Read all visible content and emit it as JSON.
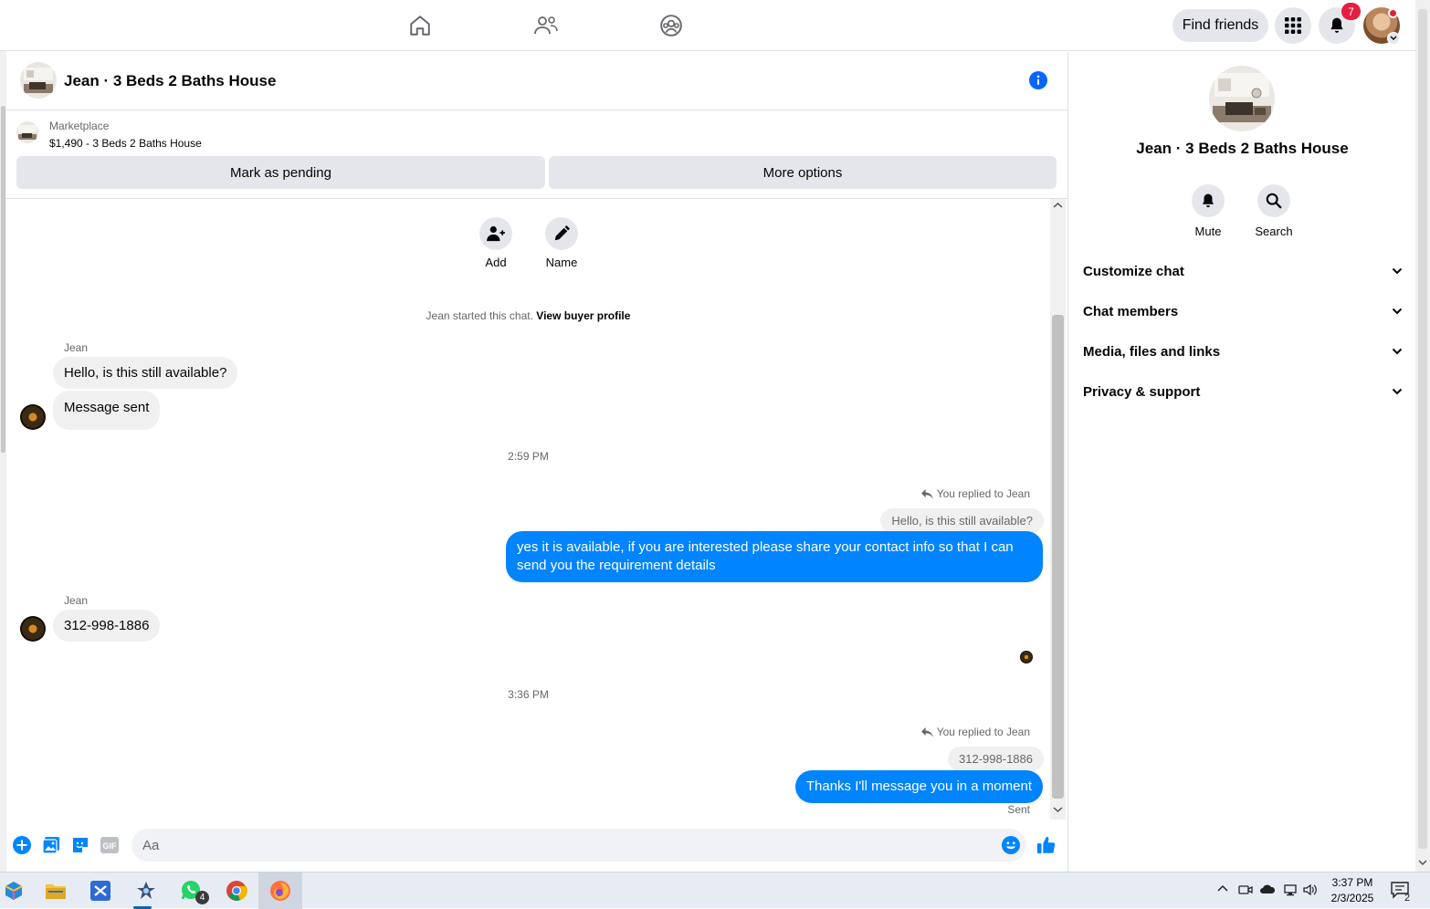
{
  "topnav": {
    "find_friends_label": "Find friends",
    "notifications_count": "7"
  },
  "chat": {
    "header_title": "Jean · 3 Beds 2 Baths House",
    "marketplace_label": "Marketplace",
    "listing_text": "$1,490 - 3 Beds 2 Baths House",
    "mark_pending_label": "Mark as pending",
    "more_options_label": "More options"
  },
  "thread_tools": {
    "add_label": "Add",
    "name_label": "Name"
  },
  "messages": {
    "started_text": "Jean started this chat.",
    "view_profile_link": "View buyer profile",
    "sender_name_1": "Jean",
    "in_msg_1": "Hello, is this still available?",
    "in_msg_2": "Message sent",
    "time_1": "2:59 PM",
    "reply_note_1": "You replied to Jean",
    "quote_1": "Hello, is this still available?",
    "out_msg_1": "yes it is available, if you are interested please share your contact info so that I can send you the requirement details",
    "sender_name_2": "Jean",
    "in_msg_3": "312-998-1886",
    "time_2": "3:36 PM",
    "reply_note_2": "You replied to Jean",
    "quote_2": "312-998-1886",
    "out_msg_2": "Thanks I'll message you in a moment",
    "status": "Sent"
  },
  "composer": {
    "placeholder": "Aa",
    "gif_label": "GIF"
  },
  "right_panel": {
    "title": "Jean · 3 Beds 2 Baths House",
    "mute_label": "Mute",
    "search_label": "Search",
    "sections": [
      "Customize chat",
      "Chat members",
      "Media, files and links",
      "Privacy & support"
    ]
  },
  "taskbar": {
    "time": "3:37 PM",
    "date": "2/3/2025",
    "whatsapp_badge": "4",
    "notifications_badge": "2"
  },
  "colors": {
    "accent": "#0084ff",
    "badge": "#e41e3f",
    "bubble_in": "#f0f0f0",
    "button_bg": "#e4e6eb"
  }
}
